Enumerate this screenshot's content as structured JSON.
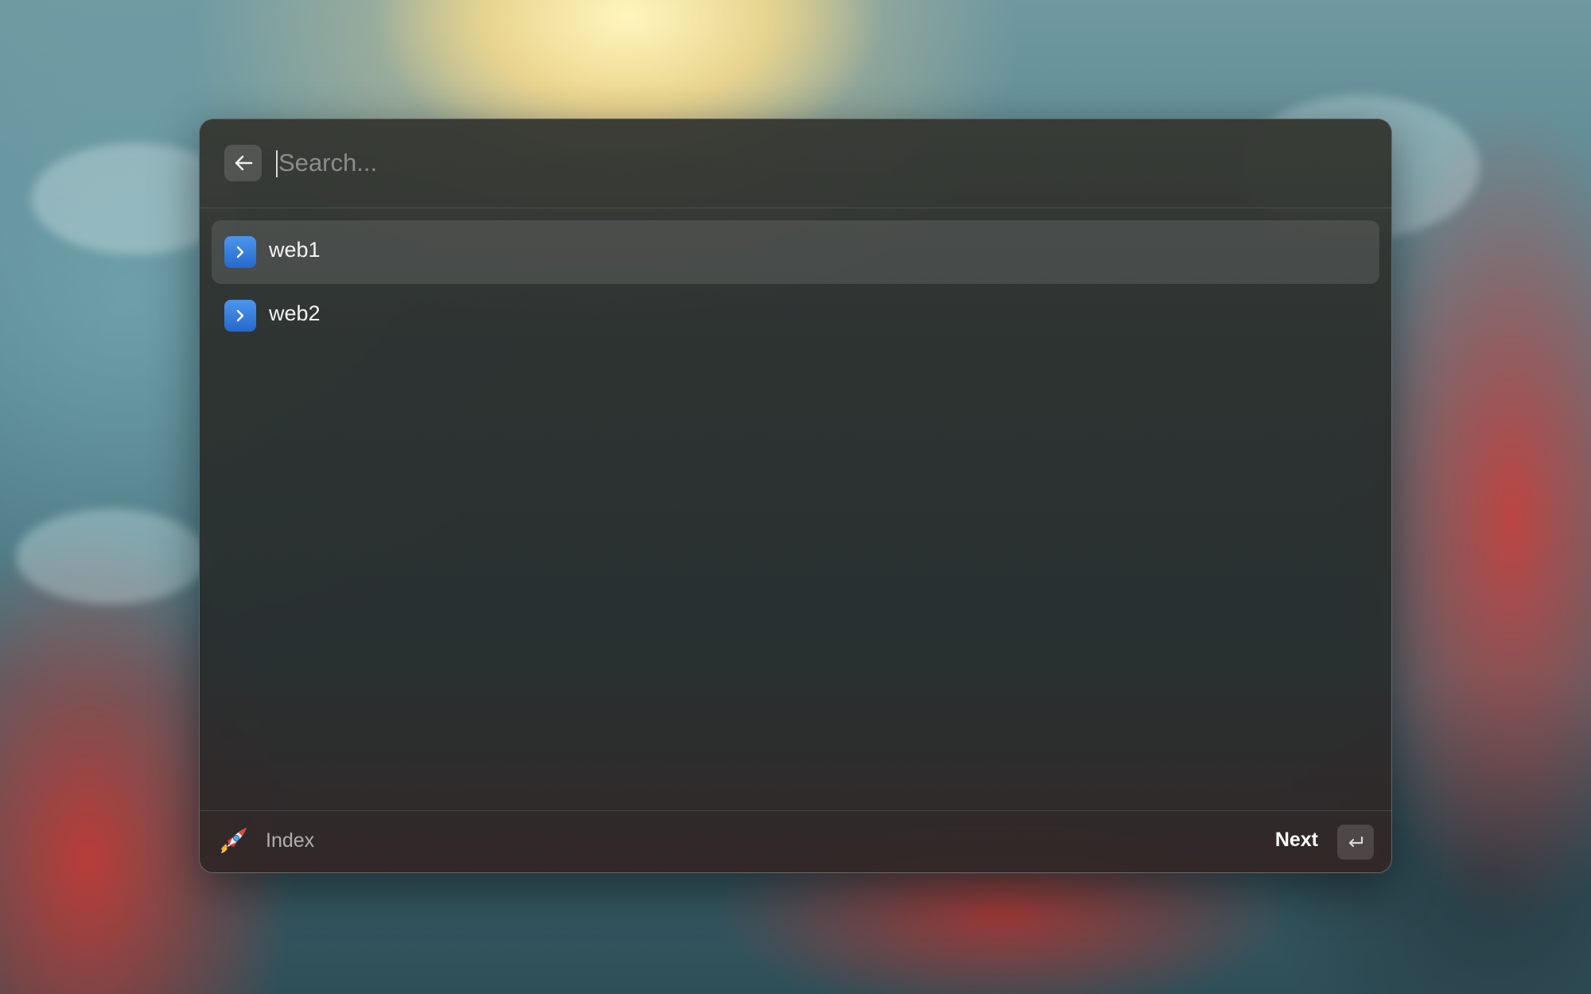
{
  "search": {
    "placeholder": "Search...",
    "value": ""
  },
  "results": [
    {
      "label": "web1",
      "icon": "chevron-right-icon",
      "selected": true
    },
    {
      "label": "web2",
      "icon": "chevron-right-icon",
      "selected": false
    }
  ],
  "footer": {
    "title": "Index",
    "app_icon": "rocket-icon",
    "action_label": "Next",
    "action_key_icon": "return-key-icon"
  },
  "colors": {
    "item_icon": "#3a7fdd",
    "selected_row": "rgba(255,255,255,0.11)"
  }
}
